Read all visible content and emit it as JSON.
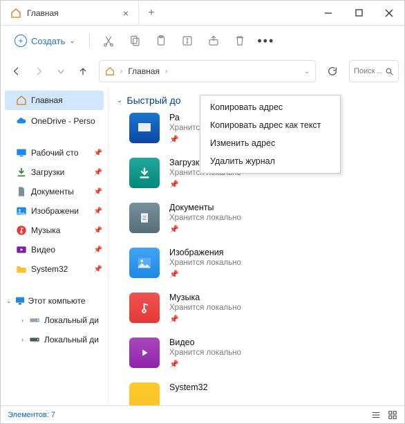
{
  "tab": {
    "title": "Главная"
  },
  "toolbar": {
    "create": "Создать"
  },
  "breadcrumb": {
    "root": "Главная"
  },
  "search": {
    "placeholder": "Поиск ..."
  },
  "sidebar": {
    "home": "Главная",
    "onedrive": "OneDrive - Perso",
    "quick": {
      "desktop": "Рабочий сто",
      "downloads": "Загрузки",
      "documents": "Документы",
      "pictures": "Изображени",
      "music": "Музыка",
      "videos": "Видео",
      "system32": "System32"
    },
    "thispc": "Этот компьюте",
    "localdisk1": "Локальный ди",
    "localdisk2": "Локальный ди"
  },
  "section": {
    "quick": "Быстрый до"
  },
  "subtitle": "Хранится локально",
  "items": {
    "desktop": "Ра",
    "downloads": "Загрузки",
    "documents": "Документы",
    "pictures": "Изображения",
    "music": "Музыка",
    "videos": "Видео",
    "system32": "System32"
  },
  "context": {
    "copy_addr": "Копировать адрес",
    "copy_addr_text": "Копировать адрес как текст",
    "edit_addr": "Изменить адрес",
    "clear_history": "Удалить журнал"
  },
  "status": {
    "count_label": "Элементов: 7"
  }
}
